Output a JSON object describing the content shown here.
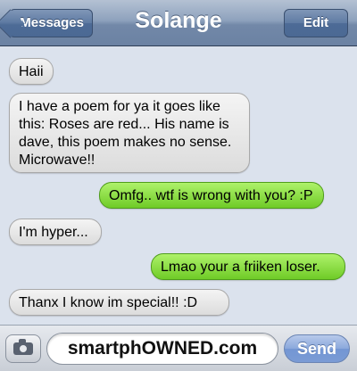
{
  "header": {
    "title": "Solange",
    "back_label": "Messages",
    "edit_label": "Edit"
  },
  "messages": [
    {
      "direction": "incoming",
      "text": "Haii"
    },
    {
      "direction": "incoming",
      "text": "I have a poem for ya it goes like this: Roses are red... His name is dave, this poem makes no sense. Microwave!!"
    },
    {
      "direction": "outgoing",
      "text": "Omfg.. wtf is wrong with you? :P"
    },
    {
      "direction": "incoming",
      "text": "I'm hyper..."
    },
    {
      "direction": "outgoing",
      "text": "Lmao your a friiken loser."
    },
    {
      "direction": "incoming",
      "text": "Thanx I know im special!! :D"
    }
  ],
  "composer": {
    "camera_icon": "camera-icon",
    "field_text": "smartphOWNED.com",
    "send_label": "Send"
  },
  "colors": {
    "navbar": "#7288a8",
    "incoming_bubble": "#e8e8e8",
    "outgoing_bubble": "#8cdd45",
    "background": "#dbe2ed",
    "send_button": "#7a9bd5"
  }
}
